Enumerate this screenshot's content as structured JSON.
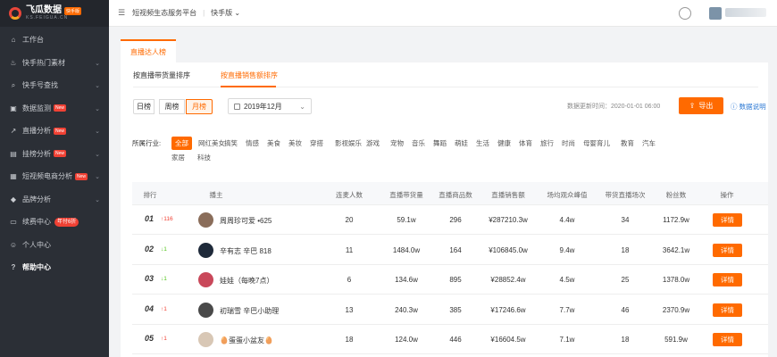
{
  "logo": {
    "name": "飞瓜数据",
    "badge": "快手版",
    "sub": "KS.FEIGUA.CN"
  },
  "sidebar": {
    "items": [
      {
        "icon": "home-icon",
        "label": "工作台",
        "chevron": false
      },
      {
        "icon": "flame-icon",
        "label": "快手热门素材",
        "chevron": true
      },
      {
        "icon": "search-icon",
        "label": "快手号查找",
        "chevron": true
      },
      {
        "icon": "monitor-icon",
        "label": "数据监测",
        "tag": "New",
        "chevron": true
      },
      {
        "icon": "trend-icon",
        "label": "直播分析",
        "tag": "New",
        "chevron": true
      },
      {
        "icon": "bars-icon",
        "label": "挂榜分析",
        "tag": "New",
        "chevron": true
      },
      {
        "icon": "shop-icon",
        "label": "短视频电商分析",
        "tag": "New",
        "chevron": true
      },
      {
        "icon": "diamond-icon",
        "label": "品牌分析",
        "chevron": true
      },
      {
        "icon": "card-icon",
        "label": "续费中心",
        "tag": "年付6折",
        "chevron": false
      },
      {
        "icon": "user-icon",
        "label": "个人中心",
        "chevron": false
      },
      {
        "icon": "help-icon",
        "label": "帮助中心",
        "chevron": false,
        "bold": true
      }
    ]
  },
  "topbar": {
    "platform": "短视频生态服务平台",
    "version": "快手版"
  },
  "tab": "直播达人榜",
  "subtabs": [
    "按直播带货量排序",
    "按直播销售额排序"
  ],
  "periods": [
    "日榜",
    "周榜",
    "月榜"
  ],
  "month": "2019年12月",
  "update_time": "数据更新时间：2020-01-01 06:00",
  "export_label": "导出",
  "help_label": "数据说明",
  "filter": {
    "label": "所属行业:",
    "items": [
      "全部",
      "网红美女",
      "搞笑",
      "情感",
      "美食",
      "美妆",
      "穿搭",
      "影视娱乐",
      "游戏",
      "宠物",
      "音乐",
      "舞蹈",
      "萌娃",
      "生活",
      "健康",
      "体育",
      "旅行",
      "时尚",
      "母婴育儿",
      "教育",
      "汽车",
      "家居",
      "科技"
    ]
  },
  "table": {
    "headers": [
      "排行",
      "播主",
      "连麦人数",
      "直播带货量",
      "直播商品数",
      "直播销售额",
      "场均观众峰值",
      "带货直播场次",
      "粉丝数",
      "操作"
    ],
    "detail_label": "详情",
    "rows": [
      {
        "rank": "01",
        "change": "116",
        "dir": "up",
        "host": "周周珍可爱 •625",
        "c1": "20",
        "c2": "59.1w",
        "c3": "296",
        "c4": "¥287210.3w",
        "c5": "4.4w",
        "c6": "34",
        "c7": "1172.9w",
        "avatar_color": "#8a6d5a"
      },
      {
        "rank": "02",
        "change": "1",
        "dir": "down",
        "host": "辛有志 辛巴 818",
        "c1": "11",
        "c2": "1484.0w",
        "c3": "164",
        "c4": "¥106845.0w",
        "c5": "9.4w",
        "c6": "18",
        "c7": "3642.1w",
        "avatar_color": "#1f2a3a"
      },
      {
        "rank": "03",
        "change": "1",
        "dir": "down",
        "host": "娃娃（每晚7点）",
        "c1": "6",
        "c2": "134.6w",
        "c3": "895",
        "c4": "¥28852.4w",
        "c5": "4.5w",
        "c6": "25",
        "c7": "1378.0w",
        "avatar_color": "#c9485a"
      },
      {
        "rank": "04",
        "change": "1",
        "dir": "up",
        "host": "初瑞雪 辛巴小助理",
        "c1": "13",
        "c2": "240.3w",
        "c3": "385",
        "c4": "¥17246.6w",
        "c5": "7.7w",
        "c6": "46",
        "c7": "2370.9w",
        "avatar_color": "#4a4a4a"
      },
      {
        "rank": "05",
        "change": "1",
        "dir": "up",
        "host": "🥚蛋蛋小盆友🥚",
        "c1": "18",
        "c2": "124.0w",
        "c3": "446",
        "c4": "¥16604.5w",
        "c5": "7.1w",
        "c6": "18",
        "c7": "591.9w",
        "avatar_color": "#d8c7b5"
      }
    ]
  }
}
